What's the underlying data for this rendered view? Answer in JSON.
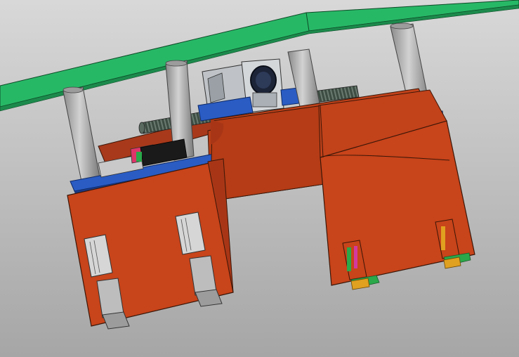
{
  "viewport": {
    "background_top": "#d6d6d6",
    "background_bottom": "#a8a8a8"
  },
  "colors": {
    "plate_green": "#27b866",
    "frame_orange": "#c2421a",
    "base_blue": "#2a5cc4",
    "post_grey": "#a9a9a9",
    "motor_black": "#1a2233",
    "screw_dark": "#3a4a40",
    "edge_dark": "#3a1608"
  },
  "model": {
    "parts": [
      "top-plate",
      "guide-post",
      "lead-screw",
      "gear-motor",
      "base-plate",
      "lifting-frame",
      "gripper-cylinder",
      "gripper-finger"
    ]
  }
}
